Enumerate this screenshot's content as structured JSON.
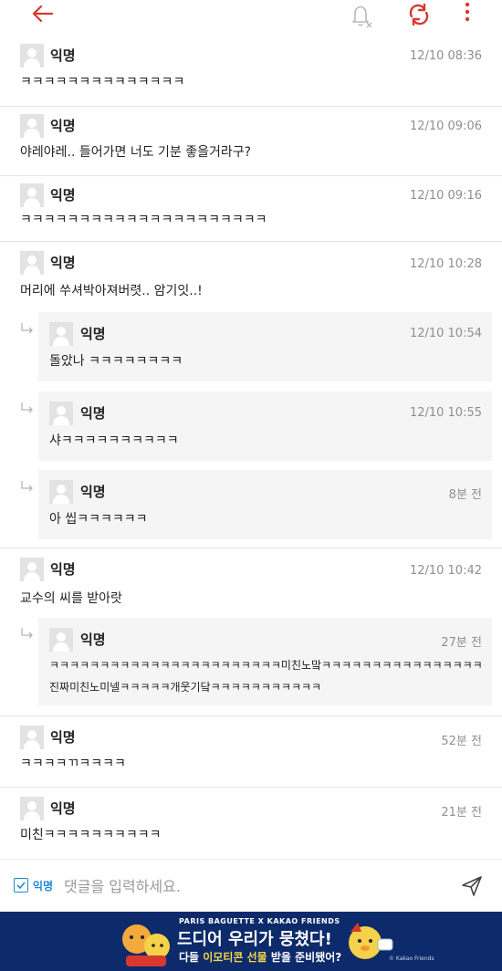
{
  "topbar": {
    "back_icon": "arrow-left-icon",
    "bell_icon": "bell-off-icon",
    "refresh_icon": "refresh-icon",
    "more_icon": "more-vertical-icon",
    "accent_color": "#d9382f"
  },
  "comments": [
    {
      "nick": "익명",
      "time": "12/10 08:36",
      "text": "ㅋㅋㅋㅋㅋㅋㅋㅋㅋㅋㅋㅋㅋㅋ"
    },
    {
      "nick": "익명",
      "time": "12/10 09:06",
      "text": "야레야레.. 들어가면 너도 기분 좋을거라구?"
    },
    {
      "nick": "익명",
      "time": "12/10 09:16",
      "text": "ㅋㅋㅋㅋㅋㅋㅋㅋㅋㅋㅋㅋㅋㅋㅋㅋㅋㅋㅋㅋㅋ"
    },
    {
      "nick": "익명",
      "time": "12/10 10:28",
      "text": "머리에 쑤셔박아져버렷.. 암기잇..!"
    },
    {
      "nick": "익명",
      "time": "12/10 10:42",
      "text": "교수의 씨를 받아랏"
    },
    {
      "nick": "익명",
      "time": "52분 전",
      "text": "ㅋㅋㅋㅋㄲㅋㅋㅋㅋ"
    },
    {
      "nick": "익명",
      "time": "21분 전",
      "text": "미친ㅋㅋㅋㅋㅋㅋㅋㅋㅋㅋ"
    }
  ],
  "replies": [
    {
      "nick": "익명",
      "time": "12/10 10:54",
      "text": "돌았나 ㅋㅋㅋㅋㅋㅋㅋㅋ"
    },
    {
      "nick": "익명",
      "time": "12/10 10:55",
      "text": "샤ㅋㅋㅋㅋㅋㅋㅋㅋㅋㅋ"
    },
    {
      "nick": "익명",
      "time": "8분 전",
      "text": "아 씹ㅋㅋㅋㅋㅋㅋ"
    },
    {
      "nick": "익명",
      "time": "27분 전",
      "text_line1": "ㅋㅋㅋㅋㅋㅋㅋㅋㅋㅋㅋㅋㅋㅋㅋㅋㅋㅋㅋㅋㅋㅋㅋ미친노맠ㅋㅋㅋㅋㅋㅋㅋㅋㅋㅋㅋㅋㅋㅋㅋㅋㅋㅋㅋㅋㅋㅋ이새기",
      "text_line2": "진짜미친노미넬ㅋㅋㅋㅋㅋ개웃기닼ㅋㅋㅋㅋㅋㅋㅋㅋㅋㅋㅋ"
    }
  ],
  "input": {
    "anon_label": "익명",
    "anon_checked": true,
    "placeholder": "댓글을 입력하세요.",
    "value": "",
    "send_icon": "send-icon"
  },
  "ad": {
    "brand_line": "PARIS BAGUETTE X KAKAO FRIENDS",
    "headline": "드디어 우리가 뭉쳤다!",
    "sub_prefix": "다들 ",
    "sub_highlight": "이모티콘 선물",
    "sub_suffix": " 받을 준비됐어?",
    "credit": "© Kakao Friends",
    "background": "#0d2a6b"
  }
}
